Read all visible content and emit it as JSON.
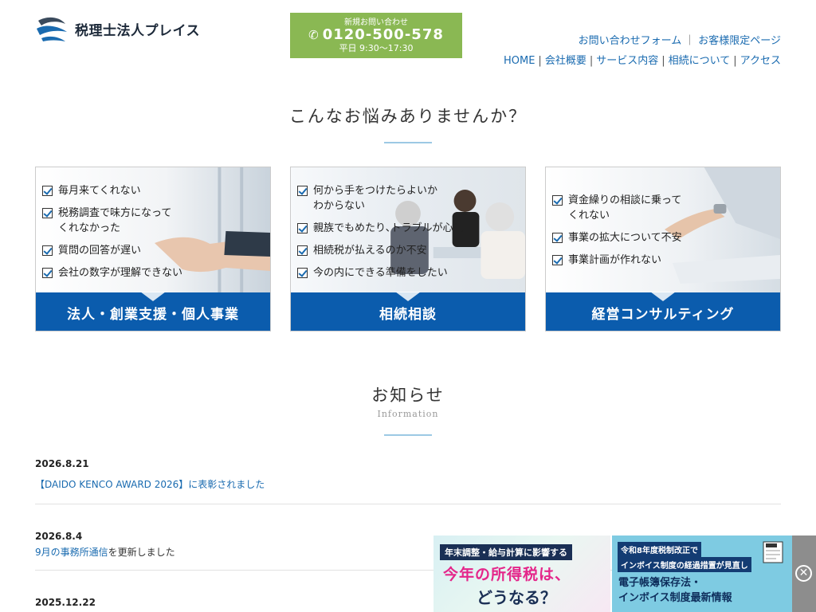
{
  "header": {
    "logo_text": "税理士法人プレイス",
    "phone": {
      "lead": "新規お問い合わせ",
      "number": "0120-500-578",
      "hours": "平日 9:30〜17:30"
    },
    "top_links": [
      "お問い合わせフォーム",
      "お客様限定ページ"
    ],
    "nav": [
      "HOME",
      "会社概要",
      "サービス内容",
      "相続について",
      "アクセス"
    ]
  },
  "worries": {
    "title": "こんなお悩みありませんか？",
    "cards": [
      {
        "items": [
          "毎月来てくれない",
          "税務調査で味方になって\nくれなかった",
          "質問の回答が遅い",
          "会社の数字が理解できない"
        ],
        "label": "法人・創業支援・個人事業"
      },
      {
        "items": [
          "何から手をつけたらよいか\nわからない",
          "親族でもめたり､トラブルが心配",
          "相続税が払えるのか不安",
          "今の内にできる準備をしたい"
        ],
        "label": "相続相談"
      },
      {
        "items": [
          "資金繰りの相談に乗って\nくれない",
          "事業の拡大について不安",
          "事業計画が作れない"
        ],
        "label": "経営コンサルティング"
      }
    ]
  },
  "news": {
    "title": "お知らせ",
    "subtitle": "Information",
    "items": [
      {
        "date": "2026.8.21",
        "link": "【DAIDO KENCO AWARD 2026】に表彰されました",
        "rest": ""
      },
      {
        "date": "2026.8.4",
        "link": "9月の事務所通信",
        "rest": "を更新しました"
      },
      {
        "date": "2025.12.22",
        "link": "",
        "rest": ""
      }
    ]
  },
  "banners": {
    "banner1": {
      "top": "年末調整・給与計算に影響する",
      "mid": "今年の所得税は、",
      "bot": "どうなる？"
    },
    "banner2": {
      "line1": "令和8年度税制改正で",
      "line2": "インボイス制度の経過措置が見直し",
      "line3": "電子帳簿保存法・\nインボイス制度最新情報"
    },
    "close_symbol": "✕"
  }
}
